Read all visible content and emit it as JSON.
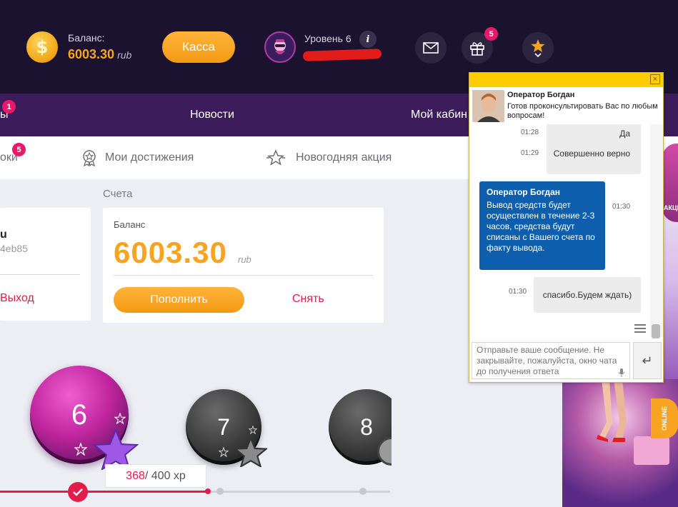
{
  "header": {
    "balance_label": "Баланс:",
    "balance_value": "6003.30",
    "balance_currency": "rub",
    "cashier_button": "Касса",
    "level_label": "Уровень 6",
    "info_symbol": "i",
    "coin_symbol": "$",
    "gift_badge": "5",
    "icons": [
      "mail-icon",
      "gift-icon",
      "star-dropdown-icon"
    ]
  },
  "nav": {
    "partial_item": "ы",
    "partial_badge": "1",
    "items": [
      "Новости",
      "Мой кабин"
    ]
  },
  "subtabs": {
    "partial_item": "оки",
    "partial_badge": "5",
    "achievements": "Мои достижения",
    "newyear": "Новогодняя акция"
  },
  "accounts": {
    "section_title": "Счета",
    "left_card": {
      "name_fragment": "u",
      "id_fragment": "4eb85",
      "logout": "Выход"
    },
    "balance_card": {
      "label": "Баланс",
      "value": "6003.30",
      "currency": "rub",
      "deposit": "Пополнить",
      "withdraw": "Снять"
    }
  },
  "levels": {
    "items": [
      "6",
      "7",
      "8"
    ],
    "xp_current": "368",
    "xp_rest": " / 400 xp",
    "progress": 0.92
  },
  "promo": {
    "online_label": "ONLINE",
    "sign_text": "АКЦИ"
  },
  "chat": {
    "close_symbol": "×",
    "operator_name": "Оператор Богдан",
    "operator_greeting": "Готов проконсультировать Вас по любым вопросам!",
    "messages": [
      {
        "from": "user",
        "time": "01:28",
        "text": "Да"
      },
      {
        "from": "user",
        "time": "01:29",
        "text": "Совершенно верно"
      },
      {
        "from": "operator",
        "time": "01:30",
        "name": "Оператор Богдан",
        "text": "Вывод средств будет осуществлен в течение 2-3 часов, средства будут списаны с Вашего счета по факту вывода."
      },
      {
        "from": "user",
        "time": "01:30",
        "text": "спасибо.Будем ждать)"
      }
    ],
    "input_placeholder": "Отправьте ваше сообщение. Не закрывайте, пожалуйста, окно чата до получения ответа",
    "send_symbol": "↵"
  },
  "colors": {
    "accent_orange": "#f7a521",
    "header_bg": "#1b1230",
    "nav_bg": "#3d1c5c",
    "red_link": "#e21d4b",
    "chat_yellow": "#ffcc00",
    "operator_blue": "#0d5fad"
  }
}
